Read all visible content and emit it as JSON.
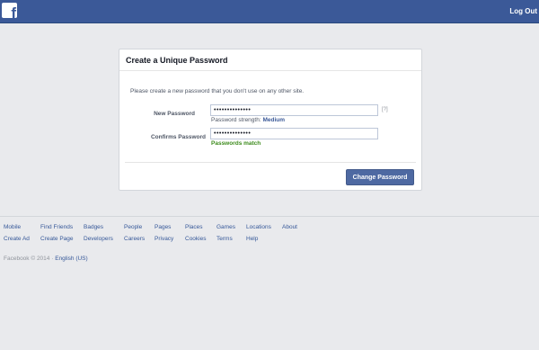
{
  "header": {
    "logo_letter": "f",
    "logout_label": "Log Out"
  },
  "card": {
    "title": "Create a Unique Password",
    "instructions": "Please create a new password that you don't use on any other site.",
    "new_password": {
      "label": "New Password",
      "value": "••••••••••••••",
      "help": "[?]"
    },
    "strength": {
      "label": "Password strength:",
      "value": "Medium"
    },
    "confirm_password": {
      "label": "Confirms Password",
      "value": "••••••••••••••"
    },
    "match_message": "Passwords match",
    "submit_label": "Change Password"
  },
  "footer": {
    "links_row1": [
      "Mobile",
      "Find Friends",
      "Badges",
      "People",
      "Pages",
      "Places",
      "Games",
      "Locations",
      "About"
    ],
    "links_row2": [
      "Create Ad",
      "Create Page",
      "Developers",
      "Careers",
      "Privacy",
      "Cookies",
      "Terms",
      "Help"
    ],
    "copyright": "Facebook © 2014 ·",
    "language": "English (US)"
  },
  "colors": {
    "brand": "#3b5998",
    "button": "#4e69a2",
    "success": "#3b8a1a",
    "background": "#e9eaed"
  }
}
